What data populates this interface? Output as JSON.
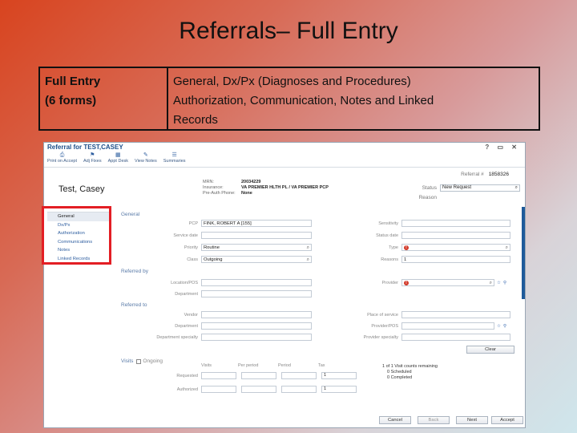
{
  "slide": {
    "title": "Referrals– Full Entry",
    "table": {
      "left_line1": "Full Entry",
      "left_line2": "(6 forms)",
      "right_line1": "General, Dx/Px (Diagnoses and Procedures)",
      "right_line2": "Authorization, Communication, Notes and Linked",
      "right_line3": "Records"
    }
  },
  "app": {
    "window_title": "Referral for TEST,CASEY",
    "window_buttons": "? ▭ ✕",
    "toolbar": [
      {
        "icon": "print-icon",
        "glyph": "⎙",
        "label": "Print on Accept"
      },
      {
        "icon": "flag-icon",
        "glyph": "⚑",
        "label": "Adj Fixes"
      },
      {
        "icon": "appointment-icon",
        "glyph": "▦",
        "label": "Appt Desk"
      },
      {
        "icon": "notes-icon",
        "glyph": "✎",
        "label": "View Notes"
      },
      {
        "icon": "summary-icon",
        "glyph": "☰",
        "label": "Summaries"
      }
    ],
    "referral_label": "Referral #",
    "referral_no": "1858326",
    "patient_name": "Test, Casey",
    "meta": {
      "mrn_label": "MRN:",
      "mrn": "20034229",
      "insurance_label": "Insurance:",
      "insurance": "VA PREMIER HLTH PL / VA PREMIER PCP",
      "preauth_label": "Pre-Auth Phone:",
      "preauth": "None"
    },
    "status_label": "Status",
    "status_value": "New Request",
    "reason_label": "Reason",
    "nav": [
      "General",
      "Dx/Px",
      "Authorization",
      "Communications",
      "Notes",
      "Linked Records"
    ],
    "sections": {
      "general": "General",
      "referred_by": "Referred by",
      "referred_to": "Referred to",
      "visits": "Visits",
      "ongoing": "Ongoing"
    },
    "general_fields": {
      "pcp_label": "PCP",
      "pcp_value": "FINK, ROBERT A [155]",
      "service_date_label": "Service date",
      "priority_label": "Priority",
      "priority_value": "Routine",
      "class_label": "Class",
      "class_value": "Outgoing",
      "sensitivity_label": "Sensitivity",
      "status_date_label": "Status date",
      "type_label": "Type",
      "reasons_label": "Reasons",
      "reasons_value": "1"
    },
    "referred_by_fields": {
      "provider_pos_label": "Location/POS",
      "department_label": "Department",
      "provider_label": "Provider"
    },
    "referred_to_fields": {
      "vendor_label": "Vendor",
      "department_label": "Department",
      "dept_specialty_label": "Department specialty",
      "place_of_service_label": "Place of service",
      "provider_pos_label": "Provider/POS",
      "provider_specialty_label": "Provider specialty"
    },
    "clear_label": "Clear",
    "visit_headers": [
      "Visits",
      "Per period",
      "Period",
      "Tax"
    ],
    "requested_label": "Requested",
    "requested_value": "1",
    "authorized_label": "Authorized",
    "authorized_value": "1",
    "remaining_line1": "1 of 1 Visit counts remaining",
    "remaining_line2": "0 Scheduled",
    "remaining_line3": "0 Completed",
    "footer": {
      "cancel": "Cancel",
      "back": "Back",
      "next": "Next",
      "accept": "Accept"
    }
  }
}
